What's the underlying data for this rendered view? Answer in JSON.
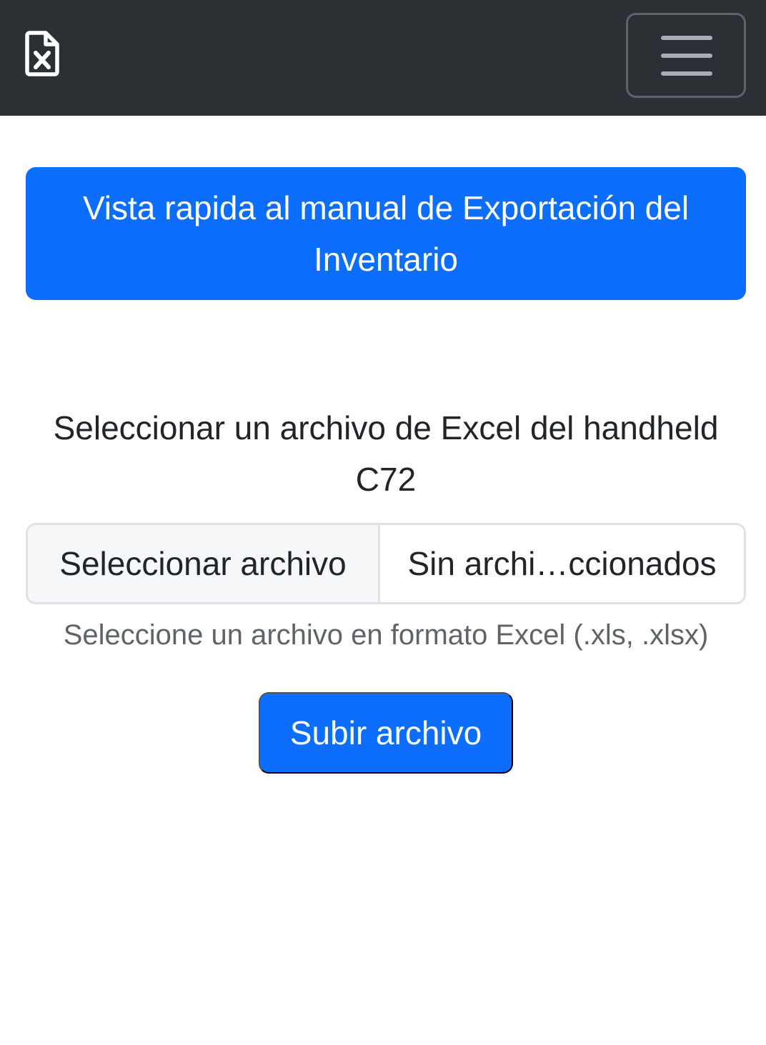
{
  "navbar": {
    "brand_icon": "file-excel-icon",
    "toggler_icon": "hamburger-menu-icon",
    "background_color": "#2b3035"
  },
  "main": {
    "manual_button_label": "Vista rapida al manual de Exportación del Inventario",
    "file_label": "Seleccionar un archivo de Excel del handheld C72",
    "file_input": {
      "button_label": "Seleccionar archivo",
      "file_name": "Sin archi…ccionados"
    },
    "help_text": "Seleccione un archivo en formato Excel (.xls, .xlsx)",
    "submit_label": "Subir archivo"
  },
  "colors": {
    "primary": "#0d6efd",
    "text": "#212529",
    "muted": "#5f6469"
  }
}
